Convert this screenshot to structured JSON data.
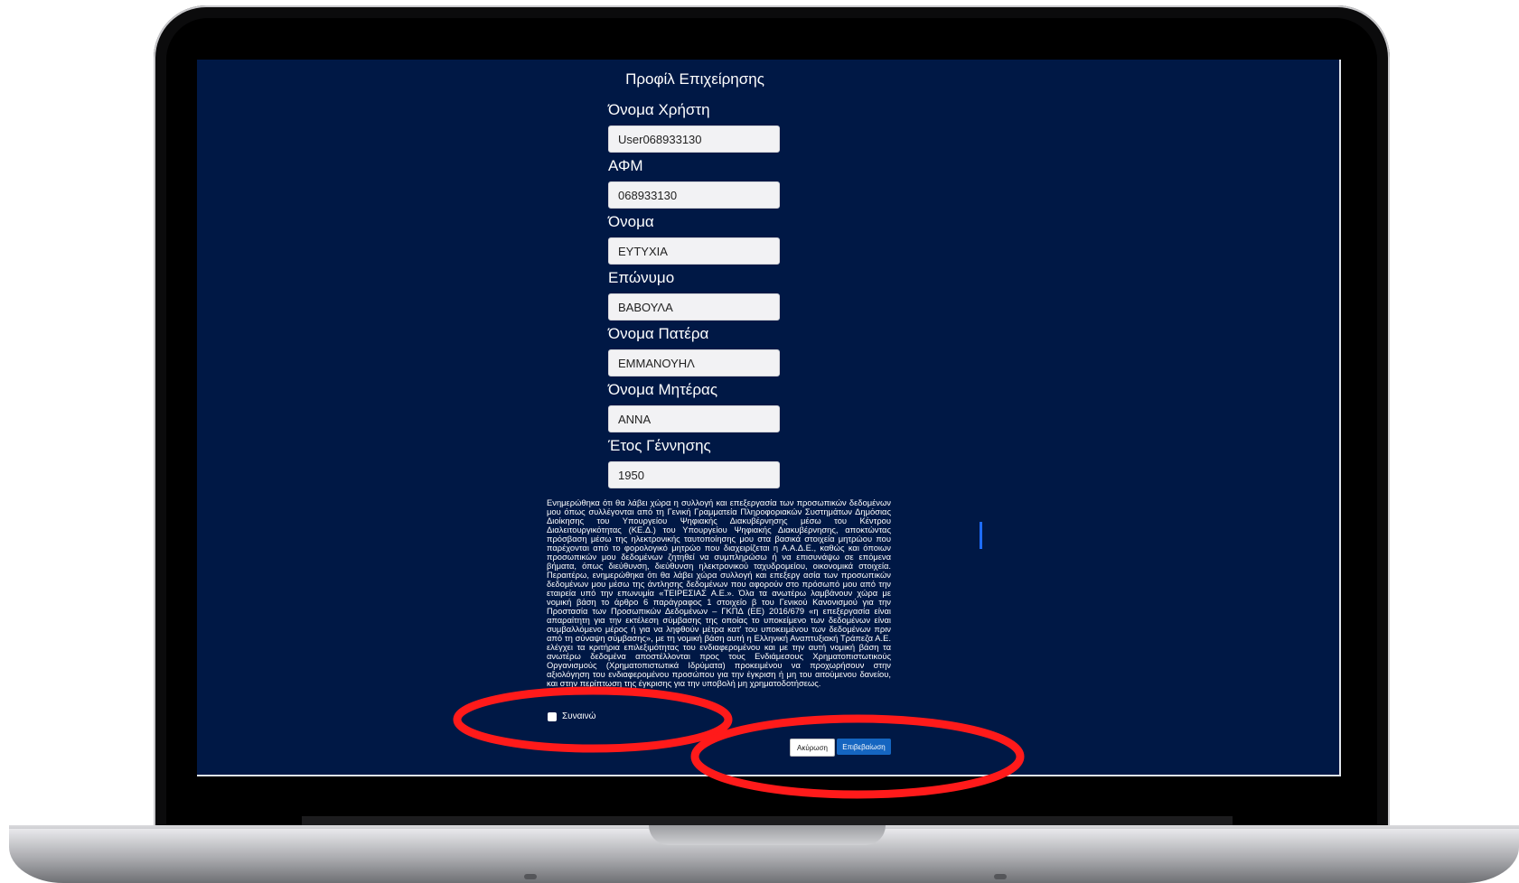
{
  "form": {
    "title": "Προφίλ Επιχείρησης",
    "fields": [
      {
        "label": "Όνομα Χρήστη",
        "value": "User068933130"
      },
      {
        "label": "ΑΦΜ",
        "value": "068933130"
      },
      {
        "label": "Όνομα",
        "value": "ΕΥΤΥΧΙΑ"
      },
      {
        "label": "Επώνυμο",
        "value": "ΒΑΒΟΥΛΑ"
      },
      {
        "label": "Όνομα Πατέρα",
        "value": "ΕΜΜΑΝΟΥΗΛ"
      },
      {
        "label": "Όνομα Μητέρας",
        "value": "ΑΝΝΑ"
      },
      {
        "label": "Έτος Γέννησης",
        "value": "1950"
      }
    ],
    "consent_text": "Ενημερώθηκα ότι θα λάβει χώρα η συλλογή και επεξεργασία των προσωπικών δεδομένων μου όπως συλλέγονται από τη Γενική Γραμματεία Πληροφοριακών Συστημάτων Δημόσιας Διοίκησης του Υπουργείου Ψηφιακής Διακυβέρνησης μέσω του Κέντρου Διαλειτουργικότητας (ΚΕ.Δ.) του Υπουργείου Ψηφιακής Διακυβέρνησης, αποκτώντας πρόσβαση μέσω της ηλεκτρονικής ταυτοποίησης μου στα βασικά στοιχεία μητρώου που παρέχονται από το φορολογικό μητρώο που διαχειρίζεται η Α.Α.Δ.Ε., καθώς και όποιων προσωπικών μου δεδομένων ζητηθεί να συμπληρώσω ή να επισυνάψω σε επόμενα βήματα, όπως διεύθυνση, διεύθυνση ηλεκτρονικού ταχυδρομείου, οικονομικά στοιχεία. Περαιτέρω, ενημερώθηκα ότι θα λάβει χώρα συλλογή και επεξεργ ασία των προσωπικών δεδομένων μου μέσω της άντλησης δεδομένων που αφορούν στο πρόσωπό μου από την εταιρεία υπό την επωνυμία «ΤΕΙΡΕΣΙΑΣ Α.Ε.». Όλα τα ανωτέρω λαμβάνουν χώρα με νομική βάση το άρθρο 6 παράγραφος 1 στοιχείο β του Γενικού Κανονισμού για την Προστασία των Προσωπικών Δεδομένων – ΓΚΠΔ (ΕΕ) 2016/679 «η επεξεργασία είναι απαραίτητη για την εκτέλεση σύμβασης της οποίας το υποκείμενο των δεδομένων είναι συμβαλλόμενο μέρος ή για να ληφθούν μέτρα κατ' του υποκειμένου των δεδομένων πριν από τη σύναψη σύμβασης», με τη νομική βάση αυτή η Ελληνική Αναπτυξιακή Τράπεζα Α.Ε. ελέγχει τα κριτήρια επιλεξιμότητας του ενδιαφερομένου και με την αυτή νομική βάση τα ανωτέρω δεδομένα αποστέλλονται προς τους Ενδιάμεσους Χρηματοπιστωτικούς Οργανισμούς (Χρηματοπιστωτικά Ιδρύματα) προκειμένου να προχωρήσουν στην αξιολόγηση του ενδιαφερομένου προσώπου για την έγκριση ή μη του αιτούμενου δανείου, και στην περίπτωση της έγκρισης για την υποβολή μη χρηματοδοτήσεως.",
    "agree_label": "Συναινώ",
    "cancel_label": "Ακύρωση",
    "confirm_label": "Επιβεβαίωση"
  },
  "colors": {
    "screen_background": "#001845",
    "confirm_button": "#1565c0",
    "annotation": "#ff1a1a"
  }
}
